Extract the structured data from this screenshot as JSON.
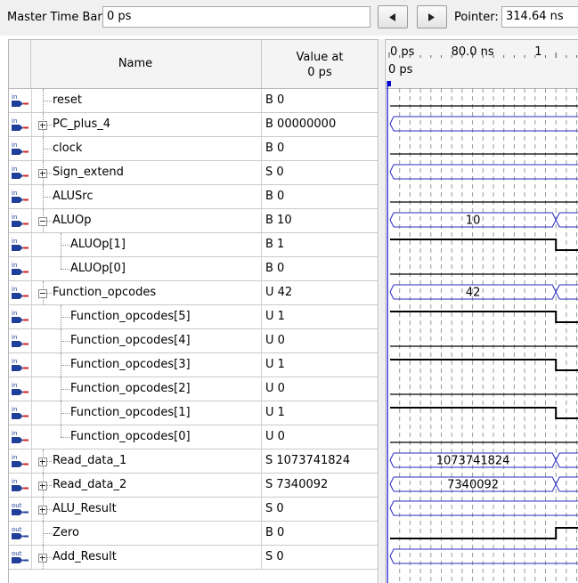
{
  "toolbar": {
    "master_label": "Master Time Bar:",
    "master_value": "0 ps",
    "prev_icon": "triangle-left-icon",
    "next_icon": "triangle-right-icon",
    "pointer_label": "Pointer:",
    "pointer_value": "314.64 ns"
  },
  "table": {
    "col_name": "Name",
    "col_value_line1": "Value at",
    "col_value_line2": "0 ps"
  },
  "timeline": {
    "ticks": [
      {
        "label": "0 ps",
        "t_ns": 0
      },
      {
        "label": "80.0 ns",
        "t_ns": 80
      },
      {
        "label": "1",
        "t_ns": 160
      }
    ],
    "cursor_label": "0 ps",
    "cursor_t_ns": 0,
    "change_t_ns": 160
  },
  "signals": [
    {
      "name": "reset",
      "value": "B 0",
      "dir": "in",
      "level": 0,
      "expander": "none",
      "wave": {
        "type": "bit",
        "a": 0,
        "b": 0
      }
    },
    {
      "name": "PC_plus_4",
      "value": "B 00000000",
      "dir": "in",
      "level": 0,
      "expander": "plus",
      "wave": {
        "type": "bus",
        "label": "",
        "change": false
      }
    },
    {
      "name": "clock",
      "value": "B 0",
      "dir": "in",
      "level": 0,
      "expander": "none",
      "wave": {
        "type": "bit",
        "a": 0,
        "b": 0
      }
    },
    {
      "name": "Sign_extend",
      "value": "S 0",
      "dir": "in",
      "level": 0,
      "expander": "plus",
      "wave": {
        "type": "bus",
        "label": "",
        "change": false
      }
    },
    {
      "name": "ALUSrc",
      "value": "B 0",
      "dir": "in",
      "level": 0,
      "expander": "none",
      "wave": {
        "type": "bit",
        "a": 0,
        "b": 0
      }
    },
    {
      "name": "ALUOp",
      "value": "B 10",
      "dir": "in",
      "level": 0,
      "expander": "minus",
      "wave": {
        "type": "bus",
        "label": "10",
        "change": true
      }
    },
    {
      "name": "ALUOp[1]",
      "value": "B 1",
      "dir": "in",
      "level": 1,
      "expander": "none",
      "wave": {
        "type": "bit",
        "a": 1,
        "b": 0
      }
    },
    {
      "name": "ALUOp[0]",
      "value": "B 0",
      "dir": "in",
      "level": 1,
      "expander": "none",
      "wave": {
        "type": "bit",
        "a": 0,
        "b": 0
      }
    },
    {
      "name": "Function_opcodes",
      "value": "U 42",
      "dir": "in",
      "level": 0,
      "expander": "minus",
      "wave": {
        "type": "bus",
        "label": "42",
        "change": true
      }
    },
    {
      "name": "Function_opcodes[5]",
      "value": "U 1",
      "dir": "in",
      "level": 1,
      "expander": "none",
      "wave": {
        "type": "bit",
        "a": 1,
        "b": 0
      }
    },
    {
      "name": "Function_opcodes[4]",
      "value": "U 0",
      "dir": "in",
      "level": 1,
      "expander": "none",
      "wave": {
        "type": "bit",
        "a": 0,
        "b": 0
      }
    },
    {
      "name": "Function_opcodes[3]",
      "value": "U 1",
      "dir": "in",
      "level": 1,
      "expander": "none",
      "wave": {
        "type": "bit",
        "a": 1,
        "b": 0
      }
    },
    {
      "name": "Function_opcodes[2]",
      "value": "U 0",
      "dir": "in",
      "level": 1,
      "expander": "none",
      "wave": {
        "type": "bit",
        "a": 0,
        "b": 0
      }
    },
    {
      "name": "Function_opcodes[1]",
      "value": "U 1",
      "dir": "in",
      "level": 1,
      "expander": "none",
      "wave": {
        "type": "bit",
        "a": 1,
        "b": 0
      }
    },
    {
      "name": "Function_opcodes[0]",
      "value": "U 0",
      "dir": "in",
      "level": 1,
      "expander": "none",
      "wave": {
        "type": "bit",
        "a": 0,
        "b": 0
      }
    },
    {
      "name": "Read_data_1",
      "value": "S 1073741824",
      "dir": "in",
      "level": 0,
      "expander": "plus",
      "wave": {
        "type": "bus",
        "label": "1073741824",
        "change": true
      }
    },
    {
      "name": "Read_data_2",
      "value": "S 7340092",
      "dir": "in",
      "level": 0,
      "expander": "plus",
      "wave": {
        "type": "bus",
        "label": "7340092",
        "change": true
      }
    },
    {
      "name": "ALU_Result",
      "value": "S 0",
      "dir": "out",
      "level": 0,
      "expander": "plus",
      "wave": {
        "type": "bus",
        "label": "",
        "change": false
      }
    },
    {
      "name": "Zero",
      "value": "B 0",
      "dir": "out",
      "level": 0,
      "expander": "none",
      "wave": {
        "type": "bit",
        "a": 0,
        "b": 1
      }
    },
    {
      "name": "Add_Result",
      "value": "S 0",
      "dir": "out",
      "level": 0,
      "expander": "plus",
      "wave": {
        "type": "bus",
        "label": "",
        "change": false
      }
    }
  ],
  "colors": {
    "waveform": "#000000",
    "bus_edge": "#2b2bbf",
    "cursor": "#0000cc",
    "grid": "#9a9a9a",
    "pin_in": "#d22222",
    "pin_body": "#1f3f99"
  }
}
